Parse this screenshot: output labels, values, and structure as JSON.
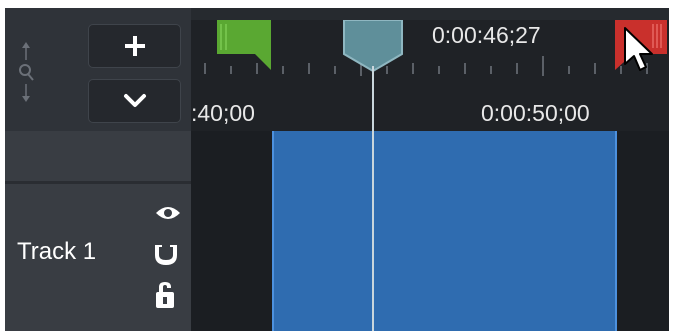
{
  "ruler": {
    "current_time": "0:00:46;27",
    "tick_left": ":40;00",
    "tick_right": "0:00:50;00"
  },
  "controls": {
    "zoom_in_icon": "plus-icon",
    "collapse_icon": "chevron-down-icon"
  },
  "track": {
    "name": "Track 1",
    "icons": [
      "eye-icon",
      "magnet-icon",
      "lock-icon"
    ]
  },
  "colors": {
    "in_marker": "#5aa832",
    "out_marker": "#c9302c",
    "playhead": "#5f8f9a",
    "clip": "#2f6cb0"
  }
}
